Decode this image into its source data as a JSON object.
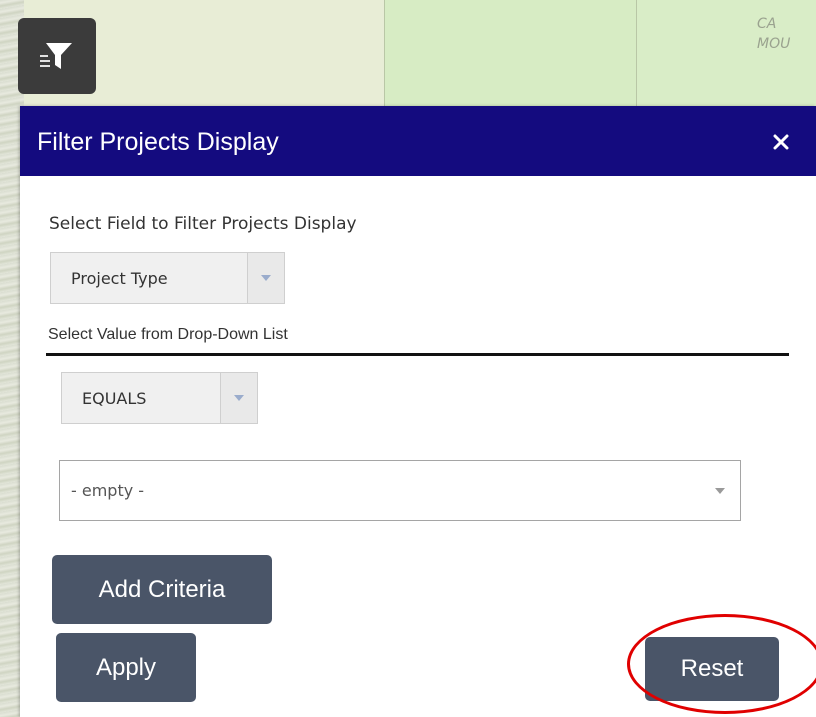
{
  "map": {
    "label": "CA\nMOU"
  },
  "panel": {
    "title": "Filter Projects Display",
    "field_label": "Select Field to Filter Projects Display",
    "field_dropdown_value": "Project Type",
    "value_label": "Select Value from Drop-Down List",
    "operator_dropdown_value": "EQUALS",
    "value_combo_text": "- empty -",
    "add_criteria_label": "Add Criteria",
    "apply_label": "Apply",
    "reset_label": "Reset"
  },
  "icons": {
    "filter": "filter-icon",
    "close": "close-icon",
    "chevron": "chevron-down-icon"
  },
  "colors": {
    "header_bg": "#140b7f",
    "button_bg": "#4a5568",
    "highlight": "#e00000"
  }
}
